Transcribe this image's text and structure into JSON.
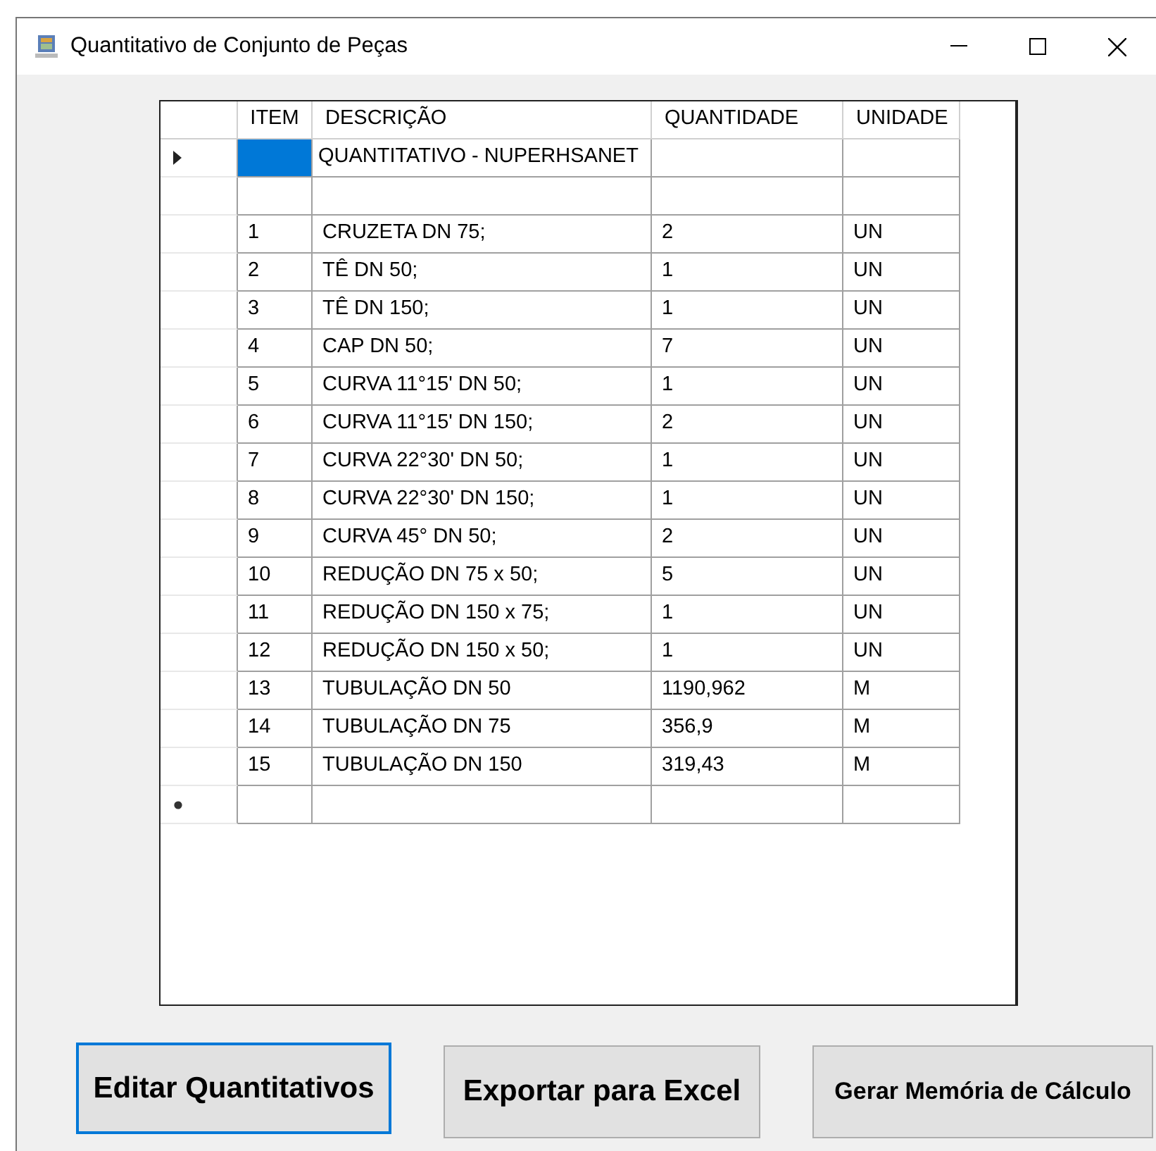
{
  "window": {
    "title": "Quantitativo de Conjunto de Peças"
  },
  "table": {
    "columns": [
      "ITEM",
      "DESCRIÇÃO",
      "QUANTIDADE",
      "UNIDADE"
    ],
    "rows": [
      {
        "kind": "data",
        "current": true,
        "item_selected": true,
        "descricao": "QUANTITATIVO - NUPERHSANET"
      },
      {
        "kind": "data",
        "current": false,
        "item_selected": false
      },
      {
        "kind": "data",
        "current": false,
        "item_selected": false,
        "item": "1",
        "descricao": "CRUZETA DN 75;",
        "quantidade": "2",
        "unidade": "UN"
      },
      {
        "kind": "data",
        "current": false,
        "item_selected": false,
        "item": "2",
        "descricao": "TÊ DN 50;",
        "quantidade": "1",
        "unidade": "UN"
      },
      {
        "kind": "data",
        "current": false,
        "item_selected": false,
        "item": "3",
        "descricao": "TÊ DN 150;",
        "quantidade": "1",
        "unidade": "UN"
      },
      {
        "kind": "data",
        "current": false,
        "item_selected": false,
        "item": "4",
        "descricao": "CAP DN 50;",
        "quantidade": "7",
        "unidade": "UN"
      },
      {
        "kind": "data",
        "current": false,
        "item_selected": false,
        "item": "5",
        "descricao": "CURVA 11°15' DN 50;",
        "quantidade": "1",
        "unidade": "UN"
      },
      {
        "kind": "data",
        "current": false,
        "item_selected": false,
        "item": "6",
        "descricao": "CURVA 11°15' DN 150;",
        "quantidade": "2",
        "unidade": "UN"
      },
      {
        "kind": "data",
        "current": false,
        "item_selected": false,
        "item": "7",
        "descricao": "CURVA 22°30' DN 50;",
        "quantidade": "1",
        "unidade": "UN"
      },
      {
        "kind": "data",
        "current": false,
        "item_selected": false,
        "item": "8",
        "descricao": "CURVA 22°30' DN 150;",
        "quantidade": "1",
        "unidade": "UN"
      },
      {
        "kind": "data",
        "current": false,
        "item_selected": false,
        "item": "9",
        "descricao": "CURVA 45° DN 50;",
        "quantidade": "2",
        "unidade": "UN"
      },
      {
        "kind": "data",
        "current": false,
        "item_selected": false,
        "item": "10",
        "descricao": "REDUÇÃO DN 75 x 50;",
        "quantidade": "5",
        "unidade": "UN"
      },
      {
        "kind": "data",
        "current": false,
        "item_selected": false,
        "item": "11",
        "descricao": "REDUÇÃO DN 150 x 75;",
        "quantidade": "1",
        "unidade": "UN"
      },
      {
        "kind": "data",
        "current": false,
        "item_selected": false,
        "item": "12",
        "descricao": "REDUÇÃO DN 150 x 50;",
        "quantidade": "1",
        "unidade": "UN"
      },
      {
        "kind": "data",
        "current": false,
        "item_selected": false,
        "item": "13",
        "descricao": "TUBULAÇÃO DN 50",
        "quantidade": "1190,962",
        "unidade": "M"
      },
      {
        "kind": "data",
        "current": false,
        "item_selected": false,
        "item": "14",
        "descricao": "TUBULAÇÃO DN 75",
        "quantidade": "356,9",
        "unidade": "M"
      },
      {
        "kind": "data",
        "current": false,
        "item_selected": false,
        "item": "15",
        "descricao": "TUBULAÇÃO DN 150",
        "quantidade": "319,43",
        "unidade": "M"
      },
      {
        "kind": "new_row",
        "current": false,
        "item_selected": false
      }
    ]
  },
  "buttons": [
    {
      "label": "Editar Quantitativos",
      "focused": true
    },
    {
      "label": "Exportar para Excel",
      "focused": false
    },
    {
      "label": "Gerar Memória de Cálculo",
      "focused": false
    }
  ]
}
